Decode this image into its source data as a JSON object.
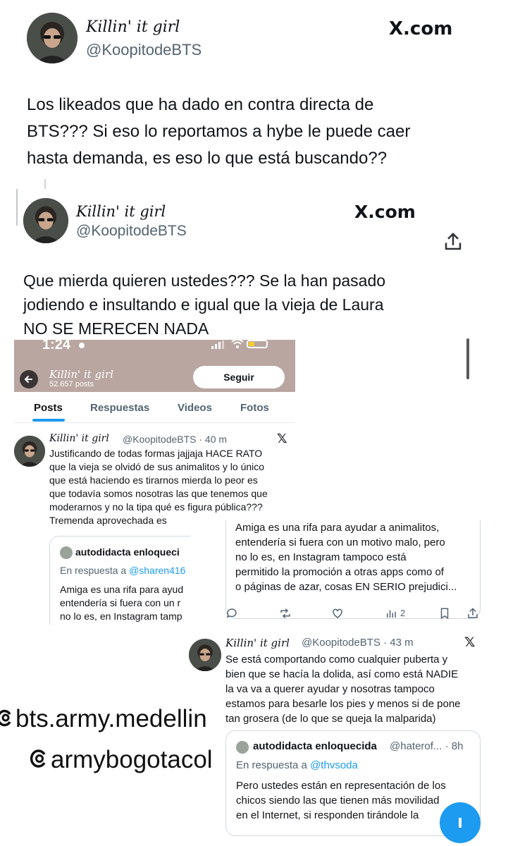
{
  "tweet1": {
    "display_name": "Killin' it girl",
    "handle": "@KoopitodeBTS",
    "brand": "X.com",
    "text_lines": [
      "Los likeados que ha dado en contra directa de",
      "BTS??? Si eso lo reportamos a hybe le puede caer",
      "hasta demanda, es eso lo que está buscando??"
    ]
  },
  "tweet2": {
    "display_name": "Killin' it girl",
    "handle": "@KoopitodeBTS",
    "brand": "X.com",
    "text_lines": [
      "Que mierda quieren ustedes??? Se la han pasado",
      "jodiendo e insultando e igual que la vieja de Laura",
      "NO SE MERECEN NADA"
    ]
  },
  "profile": {
    "time": "1:24",
    "name": "Killin' it girl",
    "posts_count": "52.657 posts",
    "follow_label": "Seguir",
    "tabs": [
      "Posts",
      "Respuestas",
      "Videos",
      "Fotos"
    ]
  },
  "post1": {
    "display_name": "Killin' it girl",
    "meta": "@KoopitodeBTS · 40 m",
    "text_lines": [
      "Justificando de todas formas jajjaja HACE RATO",
      "que la vieja se olvidó de sus animalitos y lo único",
      "que está haciendo es tirarnos mierda lo peor es",
      "que todavía somos nosotras las que tenemos que",
      "moderarnos y no la tipa qué es figura pública???",
      "Tremenda aprovechada es"
    ],
    "quote": {
      "name": "autodidacta enloqueci",
      "reply_prefix": "En respuesta a",
      "reply_to": "@sharen416",
      "text_lines": [
        "Amiga es una rifa para ayud",
        "entendería si fuera con un r",
        "no lo es, en Instagram tamp"
      ]
    }
  },
  "quote_full": {
    "text_lines": [
      "Amiga es una rifa para ayudar a animalitos,",
      "entendería si fuera con un motivo malo, pero",
      "no lo es, en Instagram tampoco está",
      "permitido la promoción a otras apps como of",
      "o páginas de azar, cosas EN SERIO prejudici..."
    ],
    "views": "2"
  },
  "post2": {
    "display_name": "Killin' it girl",
    "meta": "@KoopitodeBTS · 43 m",
    "text_lines": [
      "Se está comportando como cualquier puberta y",
      "bien que se hacía la dolida, así como está NADIE",
      "la va va a querer ayudar y nosotras tampoco",
      "estamos para besarle los pies y menos si de pone",
      "tan grosera (de lo que se queja la malparida)"
    ],
    "quote": {
      "name": "autodidacta enloquecida",
      "meta": "@haterof... · 8h",
      "reply_prefix": "En respuesta a",
      "reply_to": "@thvsoda",
      "text_lines": [
        "Pero ustedes están en representación de los",
        "chicos siendo las que tienen más movilidad",
        "en el Internet, si responden tirándole la"
      ]
    }
  },
  "watermarks": [
    "@bts.army.medellin",
    "@armybogotacol"
  ]
}
